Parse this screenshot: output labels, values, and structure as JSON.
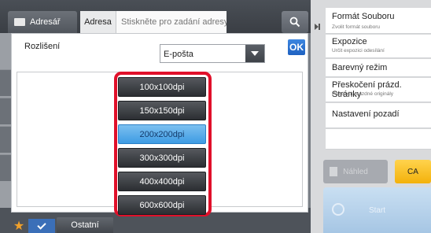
{
  "topbar": {
    "address_book_label": "Adresář",
    "address_label": "Adresa",
    "address_placeholder": "Stiskněte pro zadání adresy",
    "search_icon": "search-icon"
  },
  "dialog": {
    "title": "Rozlišení",
    "dropdown_value": "E-pošta",
    "ok_label": "OK",
    "resolutions": [
      "100x100dpi",
      "150x150dpi",
      "200x200dpi",
      "300x300dpi",
      "400x400dpi",
      "600x600dpi"
    ],
    "selected_index": 2
  },
  "right_menu": [
    {
      "title": "Formát Souboru",
      "subtitle": "Zvolit formát souboru"
    },
    {
      "title": "Expozice",
      "subtitle": "Určit expozici odesílání"
    },
    {
      "title": "Barevný režim",
      "subtitle": ""
    },
    {
      "title": "Přeskočení prázd. Stránky",
      "subtitle": "Přeskočit prázdné originály"
    },
    {
      "title": "Nastavení pozadí",
      "subtitle": ""
    }
  ],
  "actions": {
    "clear_label": "Náhled",
    "ca_label": "CA",
    "start_label": "Start"
  },
  "bottom": {
    "other_label": "Ostatní"
  },
  "colors": {
    "highlight_frame": "#e0102a",
    "selected_option": "#5aaeea",
    "ok_blue": "#2b74d2",
    "ca_yellow": "#f6c125"
  }
}
